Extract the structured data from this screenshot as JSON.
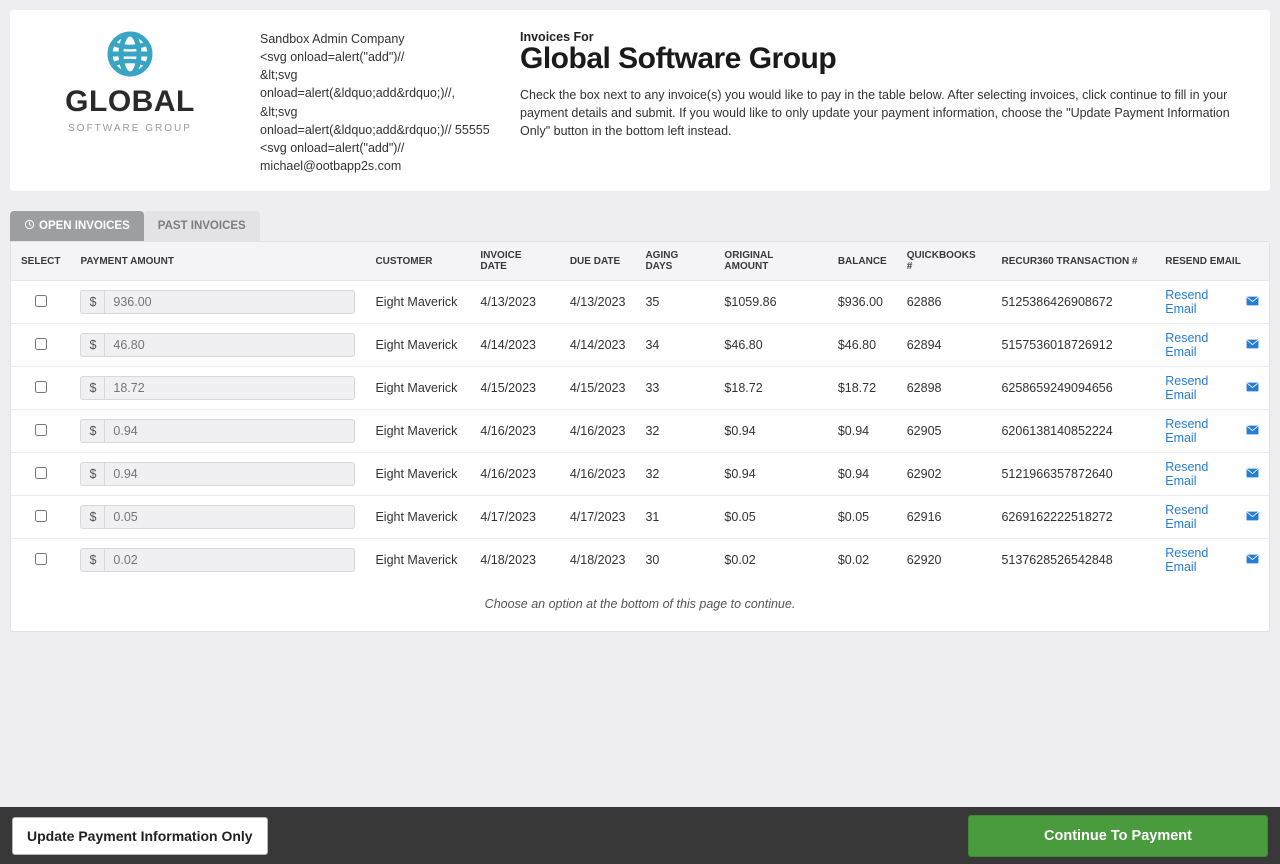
{
  "logo": {
    "name": "GLOBAL",
    "sub": "SOFTWARE GROUP"
  },
  "company": {
    "line1": "Sandbox Admin Company",
    "line2": "<svg onload=alert(\"add\")//",
    "line3": "&lt;svg onload=alert(&ldquo;add&rdquo;)//, &lt;svg onload=alert(&ldquo;add&rdquo;)// 55555",
    "line4": "<svg onload=alert(\"add\")//",
    "email": "michael@ootbapp2s.com"
  },
  "invoices_for": {
    "label": "Invoices For",
    "title": "Global Software Group",
    "desc": "Check the box next to any invoice(s) you would like to pay in the table below. After selecting invoices, click continue to fill in your payment details and submit. If you would like to only update your payment information, choose the \"Update Payment Information Only\" button in the bottom left instead."
  },
  "tabs": {
    "open": "OPEN INVOICES",
    "past": "PAST INVOICES"
  },
  "table": {
    "headers": {
      "select": "SELECT",
      "payment_amount": "PAYMENT AMOUNT",
      "customer": "CUSTOMER",
      "invoice_date": "INVOICE DATE",
      "due_date": "DUE DATE",
      "aging_days": "AGING DAYS",
      "original_amount": "ORIGINAL AMOUNT",
      "balance": "BALANCE",
      "quickbooks": "QUICKBOOKS #",
      "transaction": "RECUR360 TRANSACTION #",
      "resend": "RESEND EMAIL"
    },
    "currency_prefix": "$",
    "resend_label": "Resend Email",
    "rows": [
      {
        "amount": "936.00",
        "customer": "Eight Maverick",
        "invoice_date": "4/13/2023",
        "due_date": "4/13/2023",
        "aging": "35",
        "original": "$1059.86",
        "balance": "$936.00",
        "qb": "62886",
        "trans": "5125386426908672"
      },
      {
        "amount": "46.80",
        "customer": "Eight Maverick",
        "invoice_date": "4/14/2023",
        "due_date": "4/14/2023",
        "aging": "34",
        "original": "$46.80",
        "balance": "$46.80",
        "qb": "62894",
        "trans": "5157536018726912"
      },
      {
        "amount": "18.72",
        "customer": "Eight Maverick",
        "invoice_date": "4/15/2023",
        "due_date": "4/15/2023",
        "aging": "33",
        "original": "$18.72",
        "balance": "$18.72",
        "qb": "62898",
        "trans": "6258659249094656"
      },
      {
        "amount": "0.94",
        "customer": "Eight Maverick",
        "invoice_date": "4/16/2023",
        "due_date": "4/16/2023",
        "aging": "32",
        "original": "$0.94",
        "balance": "$0.94",
        "qb": "62905",
        "trans": "6206138140852224"
      },
      {
        "amount": "0.94",
        "customer": "Eight Maverick",
        "invoice_date": "4/16/2023",
        "due_date": "4/16/2023",
        "aging": "32",
        "original": "$0.94",
        "balance": "$0.94",
        "qb": "62902",
        "trans": "5121966357872640"
      },
      {
        "amount": "0.05",
        "customer": "Eight Maverick",
        "invoice_date": "4/17/2023",
        "due_date": "4/17/2023",
        "aging": "31",
        "original": "$0.05",
        "balance": "$0.05",
        "qb": "62916",
        "trans": "6269162222518272"
      },
      {
        "amount": "0.02",
        "customer": "Eight Maverick",
        "invoice_date": "4/18/2023",
        "due_date": "4/18/2023",
        "aging": "30",
        "original": "$0.02",
        "balance": "$0.02",
        "qb": "62920",
        "trans": "5137628526542848"
      }
    ]
  },
  "footnote": "Choose an option at the bottom of this page to continue.",
  "footer": {
    "update": "Update Payment Information Only",
    "continue": "Continue To Payment"
  }
}
